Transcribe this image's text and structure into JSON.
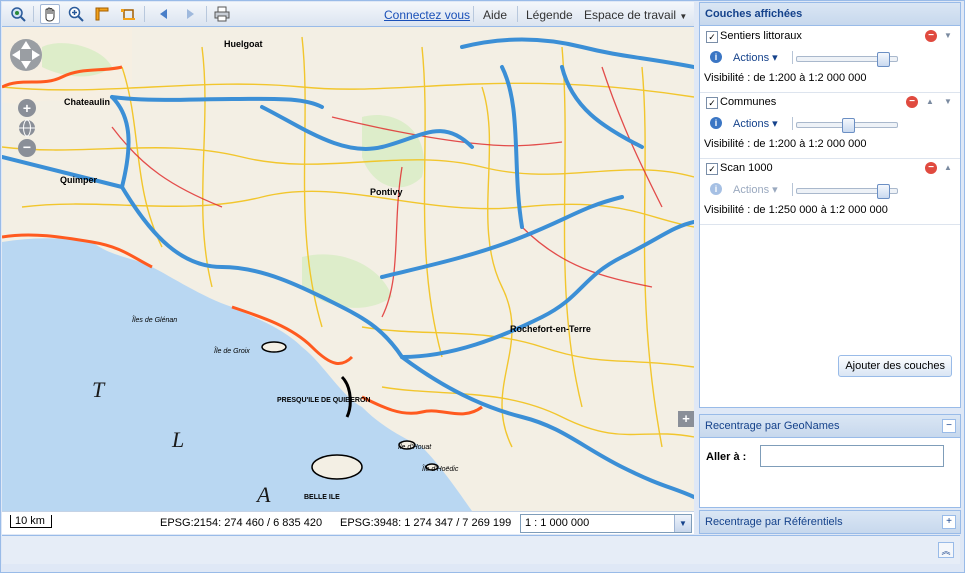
{
  "toolbar": {
    "tools": [
      {
        "icon": "zoom-extent-icon"
      },
      {
        "icon": "pan-hand-icon",
        "active": true
      },
      {
        "icon": "zoom-in-icon"
      },
      {
        "icon": "measure-length-icon"
      },
      {
        "icon": "measure-area-icon"
      },
      {
        "icon": "history-back-icon"
      },
      {
        "icon": "history-forward-icon"
      },
      {
        "icon": "print-icon"
      }
    ],
    "connect_link": "Connectez vous",
    "help": "Aide",
    "legend": "Légende",
    "workspace": "Espace de travail"
  },
  "map": {
    "labels": {
      "quimper": "Quimper",
      "chateaulin": "Chateaulin",
      "huelgoat": "Huelgoat",
      "pontivy": "Pontivy",
      "rochefort": "Rochefort-en-Terre",
      "quiberon": "PRESQU'ILE DE QUIBERON",
      "belle_ile": "BELLE ILE",
      "ile_groix": "Île de Groix",
      "ile_glenan": "Îles de Glénan",
      "ile_houat": "Île d'Houat",
      "ile_hoedic": "Île d'Hoëdic",
      "ocean_t": "T",
      "ocean_l": "L",
      "ocean_a": "A"
    },
    "scalebar": "10 km",
    "epsg2154": "EPSG:2154: 274 460 / 6 835 420",
    "epsg3948": "EPSG:3948: 1 274 347 / 7 269 199",
    "scale_value": "1 : 1 000 000"
  },
  "layers_panel": {
    "title": "Couches affichées",
    "layers": [
      {
        "name": "Sentiers littoraux",
        "actions": "Actions",
        "visibility": "Visibilité : de 1:200 à 1:2 000 000",
        "opacity": 0.9,
        "checked": true,
        "actions_enabled": true
      },
      {
        "name": "Communes",
        "actions": "Actions",
        "visibility": "Visibilité : de 1:200 à 1:2 000 000",
        "opacity": 0.5,
        "checked": true,
        "actions_enabled": true
      },
      {
        "name": "Scan 1000",
        "actions": "Actions",
        "visibility": "Visibilité : de 1:250 000 à 1:2 000 000",
        "opacity": 0.9,
        "checked": true,
        "actions_enabled": false
      }
    ],
    "add_button": "Ajouter des couches"
  },
  "geonames_panel": {
    "title": "Recentrage par GeoNames",
    "goto_label": "Aller à :",
    "goto_value": ""
  },
  "referentiels_panel": {
    "title": "Recentrage par Référentiels"
  },
  "colors": {
    "road_highway": "#3b8fd6",
    "road_primary": "#e03030",
    "road_secondary": "#f2c21a",
    "sea": "#b9d7f2",
    "land": "#f3efe4",
    "coast_trail": "#ff5a1f"
  }
}
